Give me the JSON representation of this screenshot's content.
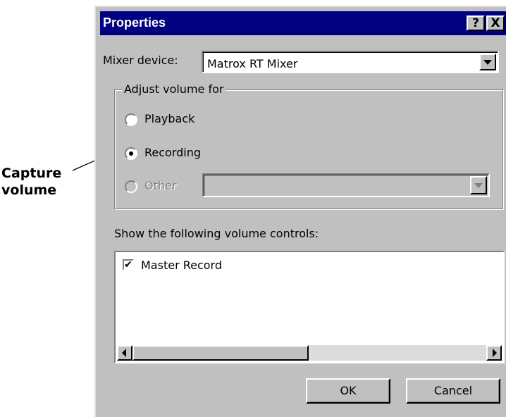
{
  "annotation": {
    "line1": "Capture",
    "line2": "volume"
  },
  "window": {
    "title": "Properties",
    "help_glyph": "?",
    "close_glyph": "X"
  },
  "mixer": {
    "label": "Mixer device:",
    "value": "Matrox RT Mixer"
  },
  "adjust_group": {
    "title": "Adjust volume for",
    "options": [
      {
        "label": "Playback",
        "checked": false,
        "enabled": true
      },
      {
        "label": "Recording",
        "checked": true,
        "enabled": true
      },
      {
        "label": "Other",
        "checked": false,
        "enabled": false
      }
    ],
    "other_value": ""
  },
  "controls": {
    "label": "Show the following volume controls:",
    "items": [
      {
        "label": "Master Record",
        "checked": true
      }
    ]
  },
  "buttons": {
    "ok": "OK",
    "cancel": "Cancel"
  },
  "check_glyph": "✔"
}
